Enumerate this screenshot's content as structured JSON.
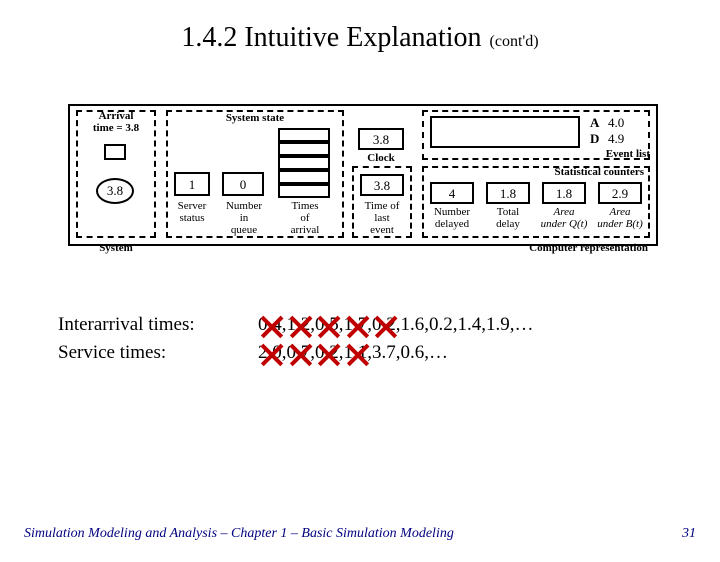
{
  "title": {
    "main": "1.4.2  Intuitive Explanation",
    "sub": "(cont'd)"
  },
  "diagram": {
    "arrival_label": "Arrival\ntime = 3.8",
    "circle_value": "3.8",
    "system_label": "System",
    "system_state_label": "System state",
    "server_status": {
      "value": "1",
      "label": "Server\nstatus"
    },
    "num_in_queue": {
      "value": "0",
      "label": "Number\nin\nqueue"
    },
    "times_of_arrival_label": "Times\nof\narrival",
    "clock": {
      "value": "3.8",
      "label": "Clock"
    },
    "time_last_event": {
      "value": "3.8",
      "label": "Time of\nlast\nevent"
    },
    "event_list": {
      "label_a": "A",
      "val_a": "4.0",
      "label_d": "D",
      "val_d": "4.9",
      "caption": "Event list"
    },
    "counters_label": "Statistical counters",
    "num_delayed": {
      "value": "4",
      "label": "Number\ndelayed"
    },
    "total_delay": {
      "value": "1.8",
      "label": "Total\ndelay"
    },
    "area_q": {
      "value": "1.8",
      "label": "Area\nunder Q(t)"
    },
    "area_b": {
      "value": "2.9",
      "label": "Area\nunder B(t)"
    },
    "comp_rep_label": "Computer representation"
  },
  "interarrival": {
    "label": "Interarrival times:",
    "values": [
      "0.4",
      "1.2",
      "0.5",
      "1.7",
      "0.2",
      "1.6",
      "0.2",
      "1.4",
      "1.9",
      "…"
    ],
    "crossed_count": 5
  },
  "service": {
    "label": "Service times:",
    "values": [
      "2.0",
      "0.7",
      "0.2",
      "1.1",
      "3.7",
      "0.6",
      "…"
    ],
    "crossed_count": 4
  },
  "footer": {
    "text": "Simulation Modeling and Analysis – Chapter 1 –  Basic Simulation Modeling",
    "page": "31"
  }
}
